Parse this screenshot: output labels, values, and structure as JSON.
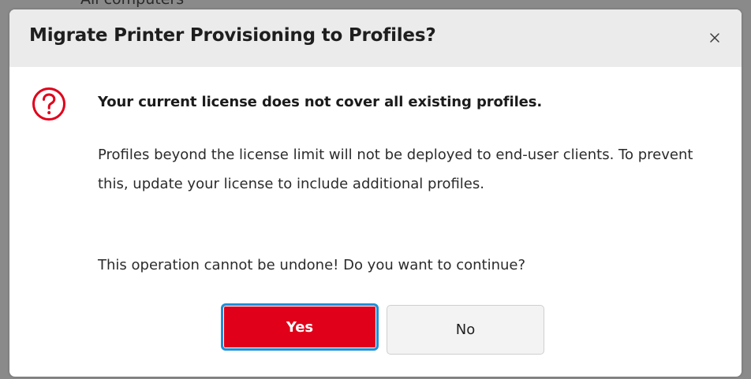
{
  "background": {
    "partial_text": "All computers"
  },
  "dialog": {
    "title": "Migrate Printer Provisioning to Profiles?",
    "close_icon": "close-icon",
    "icon": "question-circle-icon",
    "icon_color": "#e0001a",
    "headline": "Your current license does not cover all existing profiles.",
    "body": "Profiles beyond the license limit will not be deployed to end-user clients. To prevent this, update your license to include additional profiles.",
    "confirm_text": "This operation cannot be undone! Do you want to continue?",
    "buttons": {
      "yes_label": "Yes",
      "no_label": "No"
    },
    "colors": {
      "primary_button": "#e0001a",
      "focus_ring": "#1f8fd6",
      "titlebar": "#ebebeb"
    }
  }
}
